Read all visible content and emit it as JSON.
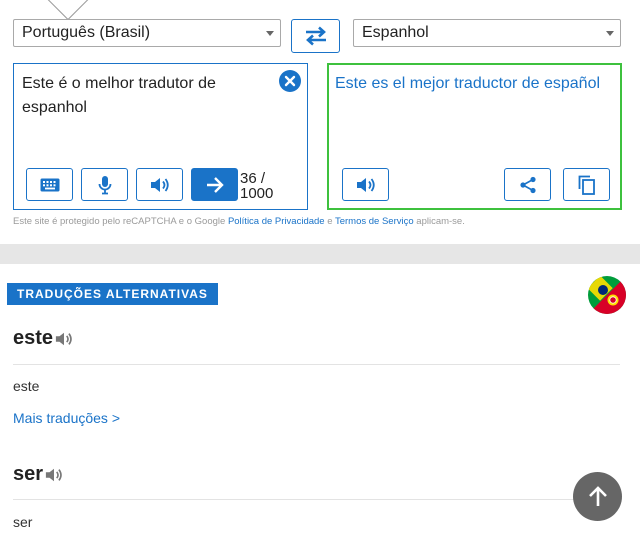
{
  "languages": {
    "source": "Português (Brasil)",
    "target": "Espanhol"
  },
  "source": {
    "text": "Este é o melhor tradutor de espanhol",
    "counter_value": "36 /",
    "counter_max": "1000"
  },
  "target": {
    "text": "Este es el mejor traductor de español"
  },
  "disclaimer": {
    "part1": "Este site é protegido pelo reCAPTCHA e o Google ",
    "privacy_link": "Política de Privacidade",
    "part2": " e ",
    "terms_link": "Termos de Serviço",
    "part3": " aplicam-se."
  },
  "alternatives": {
    "heading": "TRADUÇÕES ALTERNATIVAS",
    "entries": [
      {
        "word": "este",
        "translation": "este",
        "more": "Mais traduções >"
      },
      {
        "word": "ser",
        "translation": "ser"
      }
    ]
  },
  "colors": {
    "accent": "#1a73c8",
    "target_border": "#3ec13e",
    "scroll_button": "#666666"
  },
  "icons": [
    "swap-icon",
    "close-icon",
    "keyboard-icon",
    "microphone-icon",
    "speaker-icon",
    "arrow-right-icon",
    "share-icon",
    "copy-icon",
    "brazil-portugal-flag-icon",
    "arrow-up-icon"
  ]
}
